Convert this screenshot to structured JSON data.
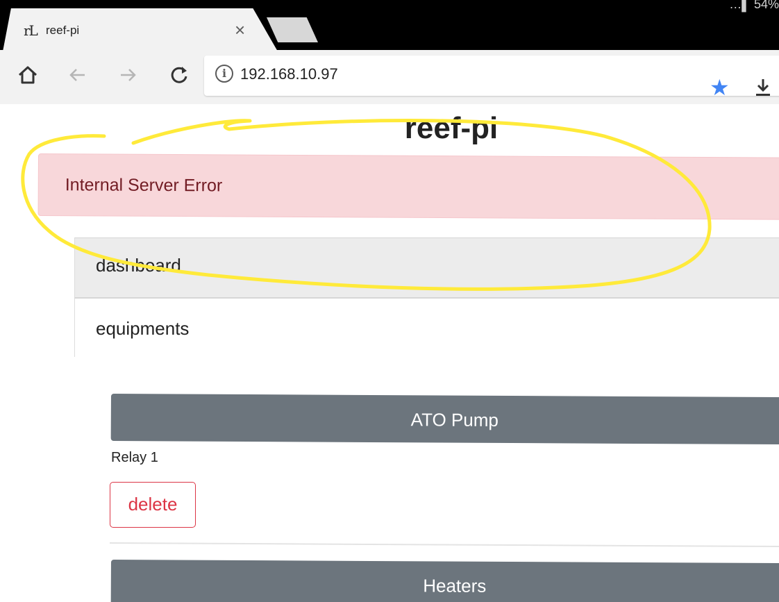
{
  "status_bar": {
    "battery": "54%"
  },
  "browser": {
    "tab": {
      "favicon_text": "rL",
      "title": "reef-pi",
      "close_glyph": "×"
    },
    "address": {
      "url": "192.168.10.97",
      "info_glyph": "i"
    },
    "bookmark_color": "#4285f4"
  },
  "page": {
    "title": "reef-pi",
    "alert": {
      "message": "Internal Server Error",
      "background": "#f8d7da",
      "text_color": "#721c24"
    },
    "nav": {
      "items": [
        {
          "label": "dashboard",
          "active": true
        },
        {
          "label": "equipments",
          "active": false
        }
      ]
    },
    "equipments": [
      {
        "name": "ATO Pump",
        "outlet": "Relay 1",
        "delete_label": "delete"
      },
      {
        "name": "Heaters"
      }
    ],
    "header_color": "#6c757d",
    "danger_color": "#dc3545",
    "annotation_color": "#ffeb3b"
  }
}
